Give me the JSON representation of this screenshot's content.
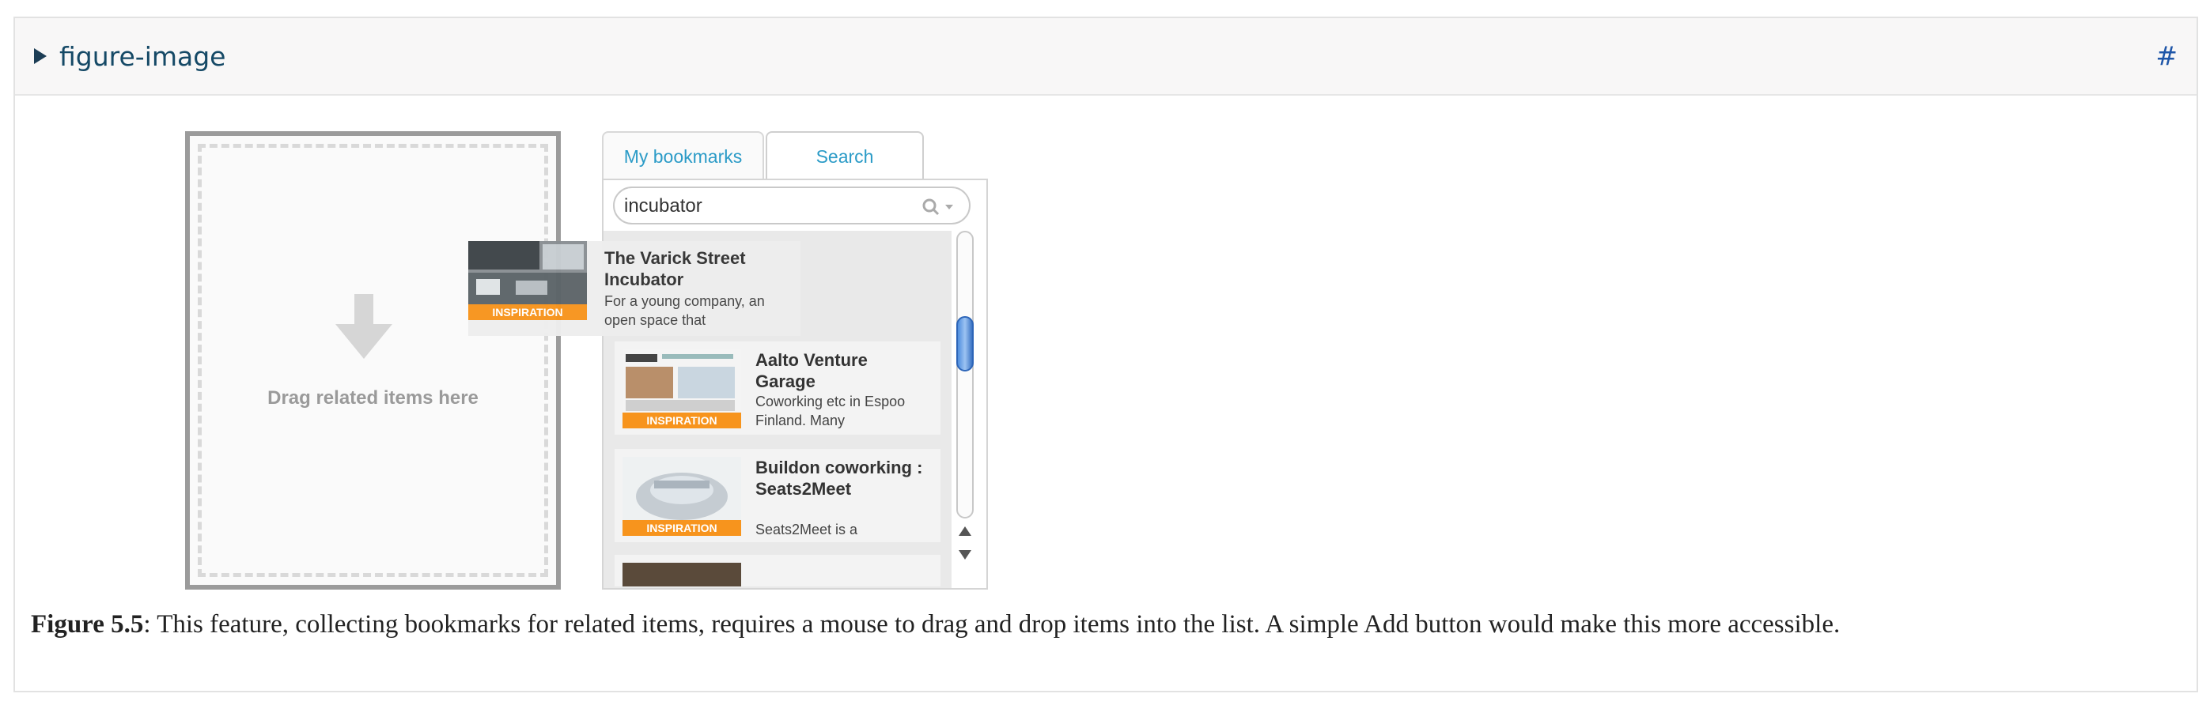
{
  "header": {
    "title": "figure-image",
    "hash": "#"
  },
  "dropzone": {
    "label": "Drag related items here"
  },
  "tabs": [
    {
      "label": "My bookmarks"
    },
    {
      "label": "Search"
    }
  ],
  "search": {
    "value": "incubator"
  },
  "badge_label": "INSPIRATION",
  "dragged_item": {
    "title": "The Varick Street Incubator",
    "description": "For a young company, an open space that"
  },
  "items": [
    {
      "title": "Aalto Venture Garage",
      "description": "Coworking etc in Espoo Finland. Many"
    },
    {
      "title": "Buildon coworking : Seats2Meet",
      "description": "Seats2Meet is a"
    }
  ],
  "caption": {
    "label": "Figure 5.5",
    "text": ": This feature, collecting bookmarks for related items, requires a mouse to drag and drop items into the list. A simple Add button would make this more accessible."
  }
}
